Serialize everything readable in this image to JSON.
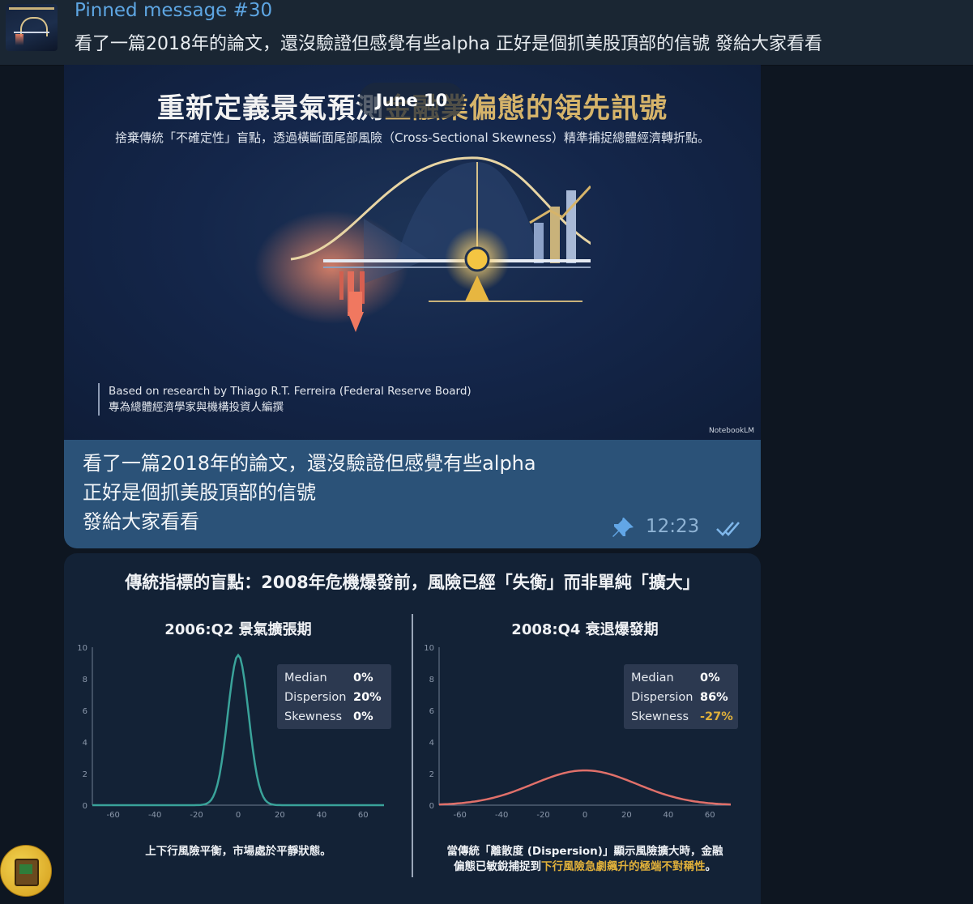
{
  "pinned": {
    "title": "Pinned message #30",
    "text": "看了一篇2018年的論文，還沒驗證但感覺有些alpha  正好是個抓美股頂部的信號 發給大家看看"
  },
  "message": {
    "date_badge": "June 10",
    "slide": {
      "title_part1": "重新定義景氣預測",
      "title_part2": "金融業偏態的領先訊號",
      "subtitle": "捨棄傳統「不確定性」盲點，透過橫斷面尾部風險（Cross-Sectional Skewness）精準捕捉總體經濟轉折點。",
      "credit_line1": "Based on research by Thiago R.T. Ferreira (Federal Reserve Board)",
      "credit_line2": "專為總體經濟學家與機構投資人編撰",
      "watermark": "NotebookLM"
    },
    "caption_lines": [
      "看了一篇2018年的論文，還沒驗證但感覺有些alpha",
      "正好是個抓美股頂部的信號",
      "發給大家看看"
    ],
    "time": "12:23"
  },
  "slide2": {
    "title": "傳統指標的盲點：2008年危機爆發前，風險已經「失衡」而非單純「擴大」",
    "panels": [
      {
        "heading": "2006:Q2 景氣擴張期",
        "stats": [
          {
            "label": "Median",
            "value": "0%"
          },
          {
            "label": "Dispersion",
            "value": "20%"
          },
          {
            "label": "Skewness",
            "value": "0%"
          }
        ],
        "note_line1": "上下行風險平衡，市場處於平靜狀態。",
        "note_line2": ""
      },
      {
        "heading": "2008:Q4 衰退爆發期",
        "stats": [
          {
            "label": "Median",
            "value": "0%"
          },
          {
            "label": "Dispersion",
            "value": "86%"
          },
          {
            "label": "Skewness",
            "value": "-27%"
          }
        ],
        "note_line1": "當傳統「離散度 (Dispersion)」顯示風險擴大時，金融",
        "note_line2_a": "偏態已敏銳捕捉到",
        "note_line2_b": "下行風險急劇飆升的極端不對稱性",
        "note_line2_c": "。"
      }
    ]
  },
  "colors": {
    "accent": "#5ea6e3",
    "bubble": "#2b5278",
    "left_curve": "#3aa39a",
    "right_curve": "#e0706a",
    "highlight": "#e0b03a"
  },
  "chart_data": [
    {
      "type": "line",
      "title": "2006:Q2 景氣擴張期",
      "x_ticks": [
        -60,
        -40,
        -20,
        0,
        20,
        40,
        60
      ],
      "y_ticks": [
        0,
        2,
        4,
        6,
        8,
        10
      ],
      "xlim": [
        -70,
        70
      ],
      "ylim": [
        0,
        10
      ],
      "series": [
        {
          "peak_x": 0,
          "peak_y": 9.5,
          "width": 5
        }
      ]
    },
    {
      "type": "line",
      "title": "2008:Q4 衰退爆發期",
      "x_ticks": [
        -60,
        -40,
        -20,
        0,
        20,
        40,
        60
      ],
      "y_ticks": [
        0,
        2,
        4,
        6,
        8,
        10
      ],
      "xlim": [
        -70,
        70
      ],
      "ylim": [
        0,
        10
      ],
      "series": [
        {
          "peak_x": 0,
          "peak_y": 2.2,
          "width": 25
        }
      ]
    }
  ]
}
